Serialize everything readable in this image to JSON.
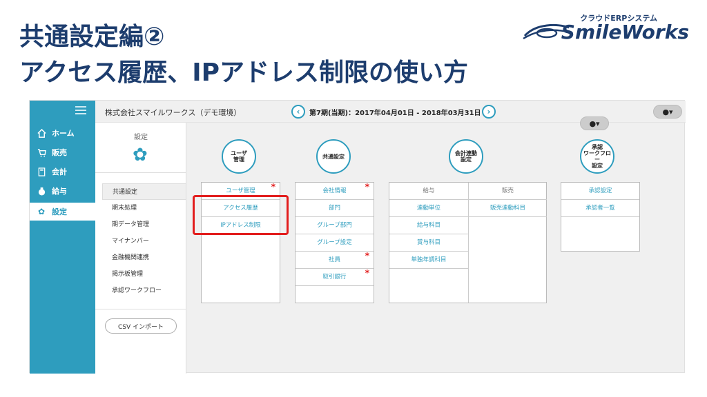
{
  "slide": {
    "title_line1": "共通設定編②",
    "title_line2": "アクセス履歴、IPアドレス制限の使い方",
    "logo_sub": "クラウドERPシステム",
    "logo_text": "SmileWorks"
  },
  "nav": {
    "items": [
      {
        "label": "ホーム",
        "icon": "home-icon"
      },
      {
        "label": "販売",
        "icon": "cart-icon"
      },
      {
        "label": "会計",
        "icon": "calculator-icon"
      },
      {
        "label": "給与",
        "icon": "money-bag-icon"
      },
      {
        "label": "設定",
        "icon": "gear-icon"
      }
    ]
  },
  "topbar": {
    "company": "株式会社スマイルワークス（デモ環境）",
    "period": "第7期(当期)：2017年04月01日 - 2018年03月31日"
  },
  "settings_panel": {
    "heading": "設定",
    "items": [
      "共通設定",
      "期末処理",
      "期データ管理",
      "マイナンバー",
      "金融機関連携",
      "掲示板管理",
      "承認ワークフロー"
    ],
    "csv_button": "CSV インポート"
  },
  "groups": {
    "user": {
      "circle": "ユーザ\n管理",
      "rows": [
        "ユーザ管理",
        "アクセス履歴",
        "IPアドレス制限"
      ]
    },
    "common": {
      "circle": "共通設定",
      "rows": [
        "会社情報",
        "部門",
        "グループ部門",
        "グループ設定",
        "社員",
        "取引銀行"
      ]
    },
    "accounting_link": {
      "circle": "会計連動\n設定",
      "payroll_header": "給与",
      "sales_header": "販売",
      "payroll_rows": [
        "連動単位",
        "給与科目",
        "賞与科目",
        "単独年調科目"
      ],
      "sales_rows": [
        "販売連動科目"
      ]
    },
    "workflow": {
      "circle": "承認\nワークフロー\n設定",
      "rows": [
        "承認設定",
        "承認者一覧"
      ]
    }
  },
  "colors": {
    "accent": "#2e9dbe",
    "title": "#1d3d6e",
    "highlight": "#e21d1d"
  }
}
